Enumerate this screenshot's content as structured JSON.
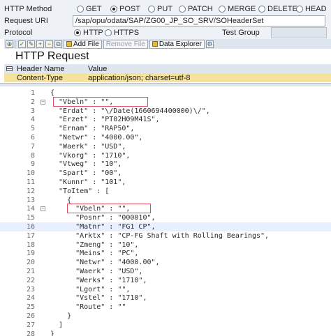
{
  "form": {
    "http_method_label": "HTTP Method",
    "methods": [
      {
        "label": "GET",
        "selected": false
      },
      {
        "label": "POST",
        "selected": true
      },
      {
        "label": "PUT",
        "selected": false
      },
      {
        "label": "PATCH",
        "selected": false
      },
      {
        "label": "MERGE",
        "selected": false
      },
      {
        "label": "DELETE",
        "selected": false
      },
      {
        "label": "HEAD",
        "selected": false
      }
    ],
    "request_uri_label": "Request URI",
    "request_uri_value": "/sap/opu/odata/SAP/ZG00_JP_SO_SRV/SOHeaderSet",
    "protocol_label": "Protocol",
    "protocols": [
      {
        "label": "HTTP",
        "selected": true
      },
      {
        "label": "HTTPS",
        "selected": false
      }
    ],
    "test_group_label": "Test Group",
    "test_group_value": ""
  },
  "toolbar": {
    "add_file_label": "Add File",
    "remove_file_label": "Remove File",
    "data_explorer_label": "Data Explorer"
  },
  "request": {
    "title": "HTTP Request",
    "header_columns": {
      "name": "Header Name",
      "value": "Value"
    },
    "headers": [
      {
        "name": "Content-Type",
        "value": "application/json; charset=utf-8"
      }
    ]
  },
  "editor": {
    "lines": [
      {
        "n": "1",
        "text": "{"
      },
      {
        "n": "2",
        "text": "  \"Vbeln\" : \"\","
      },
      {
        "n": "3",
        "text": "  \"Erdat\" : \"\\/Date(1660694400000)\\/\","
      },
      {
        "n": "4",
        "text": "  \"Erzet\" : \"PT02H09M41S\","
      },
      {
        "n": "5",
        "text": "  \"Ernam\" : \"RAP50\","
      },
      {
        "n": "6",
        "text": "  \"Netwr\" : \"4000.00\","
      },
      {
        "n": "7",
        "text": "  \"Waerk\" : \"USD\","
      },
      {
        "n": "8",
        "text": "  \"Vkorg\" : \"1710\","
      },
      {
        "n": "9",
        "text": "  \"Vtweg\" : \"10\","
      },
      {
        "n": "10",
        "text": "  \"Spart\" : \"00\","
      },
      {
        "n": "11",
        "text": "  \"Kunnr\" : \"101\","
      },
      {
        "n": "12",
        "text": "  \"ToItem\" : ["
      },
      {
        "n": "13",
        "text": "    {"
      },
      {
        "n": "14",
        "text": "      \"Vbeln\" : \"\","
      },
      {
        "n": "15",
        "text": "      \"Posnr\" : \"000010\","
      },
      {
        "n": "16",
        "text": "      \"Matnr\" : \"FG1 CP\","
      },
      {
        "n": "17",
        "text": "      \"Arktx\" : \"CP-FG Shaft with Rolling Bearings\","
      },
      {
        "n": "18",
        "text": "      \"Zmeng\" : \"10\","
      },
      {
        "n": "19",
        "text": "      \"Meins\" : \"PC\","
      },
      {
        "n": "20",
        "text": "      \"Netwr\" : \"4000.00\","
      },
      {
        "n": "21",
        "text": "      \"Waerk\" : \"USD\","
      },
      {
        "n": "22",
        "text": "      \"Werks\" : \"1710\","
      },
      {
        "n": "23",
        "text": "      \"Lgort\" : \"\","
      },
      {
        "n": "24",
        "text": "      \"Vstel\" : \"1710\","
      },
      {
        "n": "25",
        "text": "      \"Route\" : \"\""
      },
      {
        "n": "26",
        "text": "    }"
      },
      {
        "n": "27",
        "text": "  ]"
      },
      {
        "n": "28",
        "text": "}"
      }
    ]
  },
  "colors": {
    "highlight_border": "#e24a5e",
    "selected_row": "#f6e29a",
    "current_line": "#e8efff"
  }
}
